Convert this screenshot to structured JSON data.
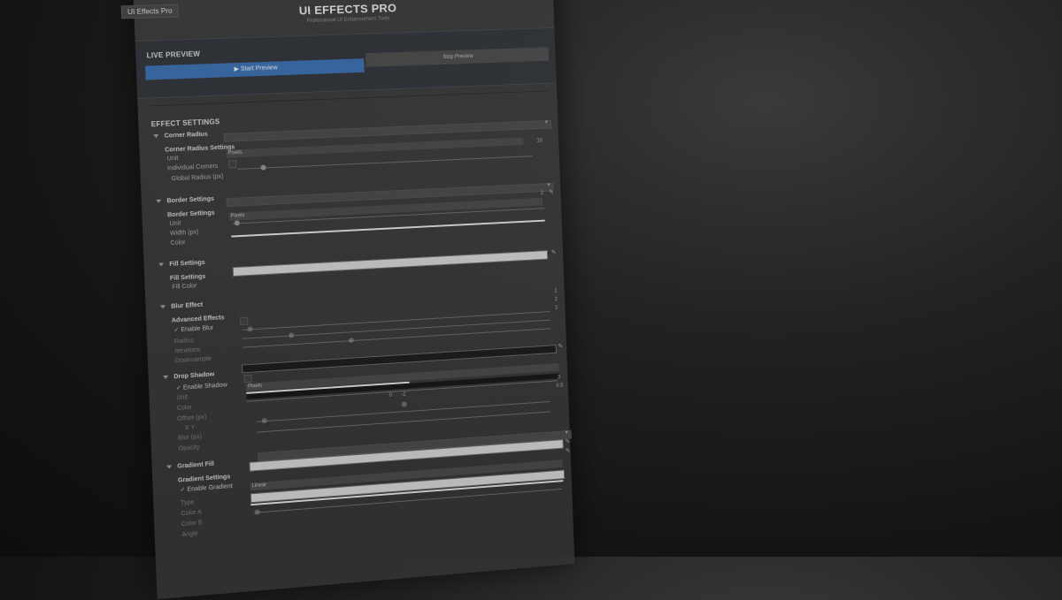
{
  "window": {
    "tab_label": "UI Effects Pro",
    "title": "UI EFFECTS PRO",
    "subtitle": "Professional UI Enhancement Tools"
  },
  "live_preview": {
    "heading": "LIVE PREVIEW",
    "start_label": "▶ Start Preview",
    "stop_label": "Stop Preview"
  },
  "effect_settings": {
    "heading": "EFFECT SETTINGS",
    "corner_radius": {
      "title": "Corner Radius",
      "subheading": "Corner Radius Settings",
      "unit_label": "Unit",
      "unit_value": "Pixels",
      "individual_label": "Individual Corners",
      "global_label": "Global Radius (px)",
      "global_value": "10"
    },
    "border": {
      "title": "Border Settings",
      "subheading": "Border Settings",
      "unit_label": "Unit",
      "unit_value": "Pixels",
      "width_label": "Width (px)",
      "width_value": "2",
      "color_label": "Color"
    },
    "fill": {
      "title": "Fill Settings",
      "subheading": "Fill Settings",
      "color_label": "Fill Color"
    },
    "blur": {
      "title": "Blur Effect",
      "subheading": "Advanced Effects",
      "enable_label": "Enable Blur",
      "radius_label": "Radius",
      "radius_value": "2",
      "iterations_label": "Iterations",
      "iterations_value": "2",
      "downsample_label": "Downsample",
      "downsample_value": "2"
    },
    "shadow": {
      "title": "Drop Shadow",
      "enable_label": "Enable Shadow",
      "unit_label": "Unit",
      "unit_value": "Pixels",
      "color_label": "Color",
      "offset_label": "Offset (px)",
      "xy_label": "X  Y",
      "offset_x": "0",
      "offset_y": "-2",
      "blur_label": "Blur (px)",
      "blur_value": "3",
      "opacity_label": "Opacity",
      "opacity_value": "0.5"
    },
    "gradient": {
      "title": "Gradient Fill",
      "subheading": "Gradient Settings",
      "enable_label": "Enable Gradient",
      "type_label": "Type",
      "type_value": "Linear",
      "color_a_label": "Color A",
      "color_b_label": "Color B",
      "angle_label": "Angle"
    }
  },
  "colors": {
    "accent": "#3a6dab",
    "panel": "#333333",
    "band": "#2f3338"
  },
  "icons": {
    "eyedropper": "eyedropper-icon",
    "collapse": "triangle-down-icon",
    "check": "check-icon"
  }
}
